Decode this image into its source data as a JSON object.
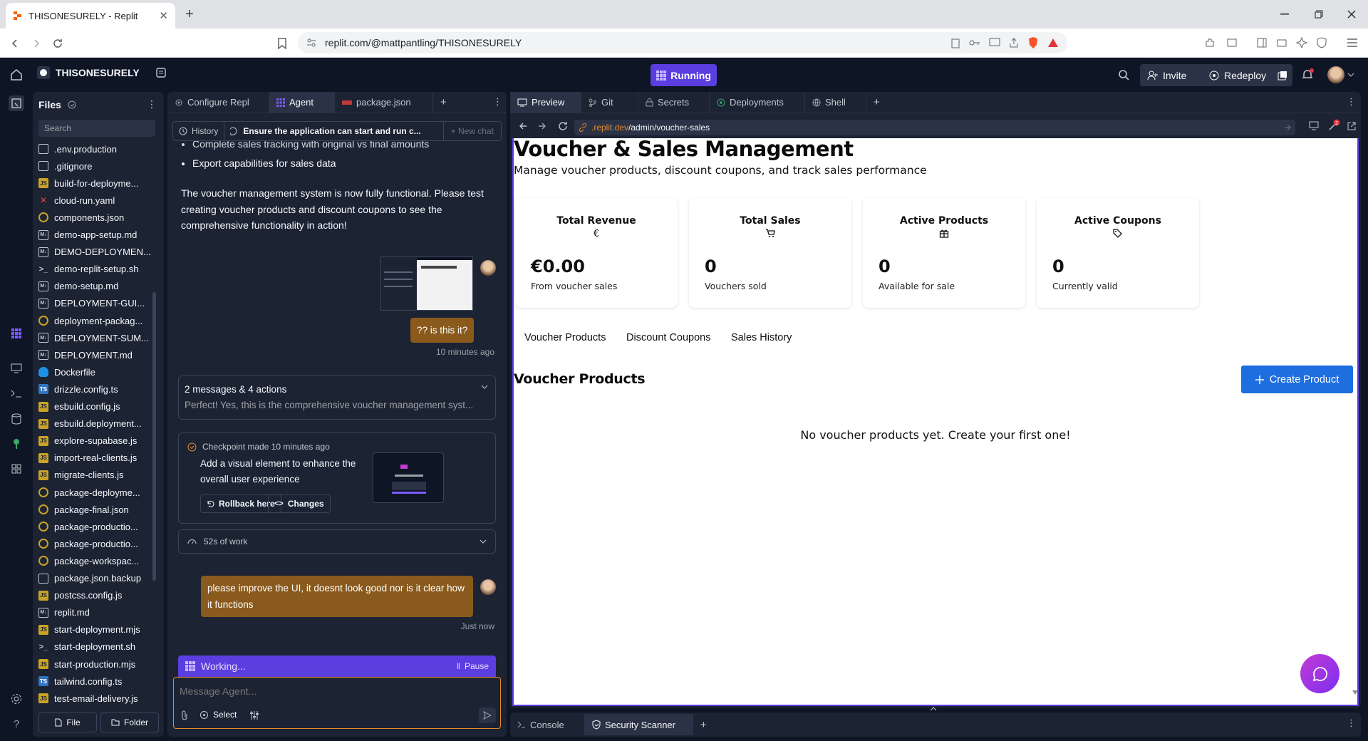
{
  "browser": {
    "tab_title": "THISONESURELY - Replit",
    "url": "replit.com/@mattpantling/THISONESURELY"
  },
  "topbar": {
    "repl_name": "THISONESURELY",
    "run_label": "Running",
    "invite_label": "Invite",
    "redeploy_label": "Redeploy"
  },
  "files": {
    "title": "Files",
    "search_placeholder": "Search",
    "items": [
      {
        "name": ".env.production",
        "type": "doc"
      },
      {
        "name": ".gitignore",
        "type": "doc"
      },
      {
        "name": "build-for-deployme...",
        "type": "js"
      },
      {
        "name": "cloud-run.yaml",
        "type": "yaml"
      },
      {
        "name": "components.json",
        "type": "json"
      },
      {
        "name": "demo-app-setup.md",
        "type": "md"
      },
      {
        "name": "DEMO-DEPLOYMEN...",
        "type": "md"
      },
      {
        "name": "demo-replit-setup.sh",
        "type": "sh"
      },
      {
        "name": "demo-setup.md",
        "type": "md"
      },
      {
        "name": "DEPLOYMENT-GUI...",
        "type": "md"
      },
      {
        "name": "deployment-packag...",
        "type": "json"
      },
      {
        "name": "DEPLOYMENT-SUM...",
        "type": "md"
      },
      {
        "name": "DEPLOYMENT.md",
        "type": "md"
      },
      {
        "name": "Dockerfile",
        "type": "docker"
      },
      {
        "name": "drizzle.config.ts",
        "type": "ts"
      },
      {
        "name": "esbuild.config.js",
        "type": "js"
      },
      {
        "name": "esbuild.deployment...",
        "type": "js"
      },
      {
        "name": "explore-supabase.js",
        "type": "js"
      },
      {
        "name": "import-real-clients.js",
        "type": "js"
      },
      {
        "name": "migrate-clients.js",
        "type": "js"
      },
      {
        "name": "package-deployme...",
        "type": "json"
      },
      {
        "name": "package-final.json",
        "type": "json"
      },
      {
        "name": "package-productio...",
        "type": "json"
      },
      {
        "name": "package-productio...",
        "type": "json"
      },
      {
        "name": "package-workspac...",
        "type": "json"
      },
      {
        "name": "package.json.backup",
        "type": "doc"
      },
      {
        "name": "postcss.config.js",
        "type": "js"
      },
      {
        "name": "replit.md",
        "type": "md"
      },
      {
        "name": "start-deployment.mjs",
        "type": "js"
      },
      {
        "name": "start-deployment.sh",
        "type": "sh"
      },
      {
        "name": "start-production.mjs",
        "type": "js"
      },
      {
        "name": "tailwind.config.ts",
        "type": "ts"
      },
      {
        "name": "test-email-delivery.js",
        "type": "js"
      }
    ],
    "new_file_label": "File",
    "new_folder_label": "Folder"
  },
  "agent_tabs": {
    "configure": "Configure Repl",
    "agent": "Agent",
    "package": "package.json"
  },
  "agent": {
    "history_label": "History",
    "current_chat": "Ensure the application can start and run c...",
    "new_chat_label": "New chat",
    "bullet_1": "Complete sales tracking with original vs final amounts",
    "bullet_2": "Export capabilities for sales data",
    "paragraph": "The voucher management system is now fully functional. Please test creating voucher products and discount coupons to see the comprehensive functionality in action!",
    "user_msg_1": "?? is this it?",
    "user_msg_1_time": "10 minutes ago",
    "summary_title": "2 messages & 4 actions",
    "summary_text": "Perfect! Yes, this is the comprehensive voucher management syst...",
    "checkpoint_label": "Checkpoint made 10 minutes ago",
    "checkpoint_desc": "Add a visual element to enhance the overall user experience",
    "rollback_label": "Rollback here",
    "changes_label": "Changes",
    "work_label": "52s of work",
    "user_msg_2": "please improve the UI, it doesnt look good nor is it clear how it functions",
    "user_msg_2_time": "Just now",
    "working_label": "Working...",
    "pause_label": "Pause",
    "input_placeholder": "Message Agent...",
    "select_label": "Select"
  },
  "preview_tabs": {
    "preview": "Preview",
    "git": "Git",
    "secrets": "Secrets",
    "deployments": "Deployments",
    "shell": "Shell"
  },
  "preview_url": {
    "domain": ".replit.dev",
    "path": "/admin/voucher-sales"
  },
  "webpage": {
    "title": "Voucher & Sales Management",
    "subtitle": "Manage voucher products, discount coupons, and track sales performance",
    "stats": [
      {
        "label": "Total Revenue",
        "icon": "euro-icon",
        "value": "€0.00",
        "sub": "From voucher sales"
      },
      {
        "label": "Total Sales",
        "icon": "cart-icon",
        "value": "0",
        "sub": "Vouchers sold"
      },
      {
        "label": "Active Products",
        "icon": "gift-icon",
        "value": "0",
        "sub": "Available for sale"
      },
      {
        "label": "Active Coupons",
        "icon": "tag-icon",
        "value": "0",
        "sub": "Currently valid"
      }
    ],
    "tabs": [
      "Voucher Products",
      "Discount Coupons",
      "Sales History"
    ],
    "section_title": "Voucher Products",
    "create_label": "Create Product",
    "empty_text": "No voucher products yet. Create your first one!"
  },
  "bottom_tabs": {
    "console": "Console",
    "security": "Security Scanner"
  },
  "colors": {
    "replit_bg": "#0e1525",
    "panel_bg": "#1c2333",
    "running_purple": "#5b3ee0",
    "user_bubble": "#8a5a1d",
    "create_button": "#1e6ee0"
  }
}
